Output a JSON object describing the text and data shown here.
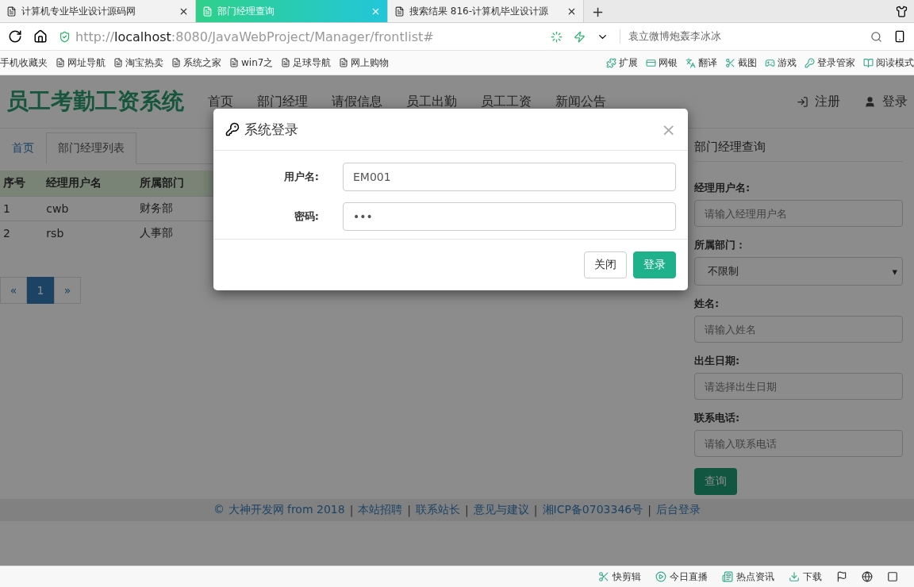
{
  "browser": {
    "tabs": [
      {
        "title": "计算机专业毕业设计源码网",
        "selected": false
      },
      {
        "title": "部门经理查询",
        "selected": true
      },
      {
        "title": "搜索结果 816-计算机毕业设计源",
        "selected": false
      }
    ],
    "new_tab": "+",
    "address": {
      "scheme": "http://",
      "host": "localhost",
      "path": ":8080/JavaWebProject/Manager/frontlist#"
    },
    "search": {
      "value": "袁立微博炮轰李冰冰"
    },
    "bookmarks": [
      "手机收藏夹",
      "网址导航",
      "淘宝热卖",
      "系统之家",
      "win7之",
      "足球导航",
      "网上购物"
    ],
    "tools": [
      "扩展",
      "网银",
      "翻译",
      "截图",
      "游戏",
      "登录管家",
      "阅读模式"
    ]
  },
  "page": {
    "brand": "员工考勤工资系统",
    "nav": [
      "首页",
      "部门经理",
      "请假信息",
      "员工出勤",
      "员工工资",
      "新闻公告"
    ],
    "user_links": [
      {
        "kind": "register",
        "label": "注册"
      },
      {
        "kind": "login",
        "label": "登录"
      }
    ],
    "tabs": [
      {
        "label": "首页",
        "selected": false
      },
      {
        "label": "部门经理列表",
        "selected": true
      }
    ],
    "table": {
      "columns": [
        "序号",
        "经理用户名",
        "所属部门"
      ],
      "rows": [
        [
          "1",
          "cwb",
          "财务部"
        ],
        [
          "2",
          "rsb",
          "人事部"
        ]
      ]
    },
    "pagination": [
      {
        "label": "«",
        "selected": false
      },
      {
        "label": "1",
        "selected": true
      },
      {
        "label": "»",
        "selected": false
      }
    ],
    "query": {
      "title": "部门经理查询",
      "fields": [
        {
          "kind": "text",
          "label": "经理用户名:",
          "placeholder": "请输入经理用户名"
        },
        {
          "kind": "select",
          "label": "所属部门：",
          "value": "不限制",
          "caret": "▾"
        },
        {
          "kind": "text",
          "label": "姓名:",
          "placeholder": "请输入姓名"
        },
        {
          "kind": "text",
          "label": "出生日期:",
          "placeholder": "请选择出生日期"
        },
        {
          "kind": "text",
          "label": "联系电话:",
          "placeholder": "请输入联系电话"
        }
      ],
      "button": "查询"
    },
    "footer": {
      "separator": "|",
      "items": [
        "© 大神开发网 from 2018",
        "本站招聘",
        "联系站长",
        "意见与建议",
        "湘ICP备0703346号",
        "后台登录"
      ]
    }
  },
  "modal": {
    "title": "系统登录",
    "close": "×",
    "fields": [
      {
        "label": "用户名:",
        "value": "EM001"
      },
      {
        "label": "密码:",
        "value": "•••"
      }
    ],
    "buttons": [
      {
        "kind": "default",
        "label": "关闭"
      },
      {
        "kind": "primary",
        "label": "登录"
      }
    ]
  },
  "status_bar": [
    "快剪辑",
    "今日直播",
    "热点资讯",
    "下载"
  ]
}
